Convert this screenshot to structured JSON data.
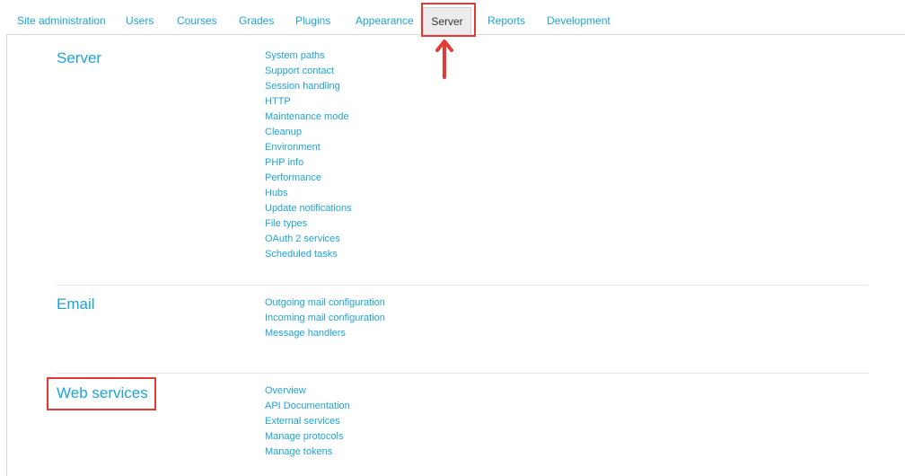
{
  "nav": {
    "tabs": [
      {
        "label": "Site administration"
      },
      {
        "label": "Users"
      },
      {
        "label": "Courses"
      },
      {
        "label": "Grades"
      },
      {
        "label": "Plugins"
      },
      {
        "label": "Appearance"
      },
      {
        "label": "Server"
      },
      {
        "label": "Reports"
      },
      {
        "label": "Development"
      }
    ],
    "active_tab": "Server"
  },
  "sections": [
    {
      "title": "Server",
      "links": [
        "System paths",
        "Support contact",
        "Session handling",
        "HTTP",
        "Maintenance mode",
        "Cleanup",
        "Environment",
        "PHP info",
        "Performance",
        "Hubs",
        "Update notifications",
        "File types",
        "OAuth 2 services",
        "Scheduled tasks"
      ]
    },
    {
      "title": "Email",
      "links": [
        "Outgoing mail configuration",
        "Incoming mail configuration",
        "Message handlers"
      ]
    },
    {
      "title": "Web services",
      "links": [
        "Overview",
        "API Documentation",
        "External services",
        "Manage protocols",
        "Manage tokens"
      ]
    }
  ],
  "colors": {
    "link": "#1ca3d6",
    "highlight": "#e53935",
    "active_tab_bg": "#ececec"
  }
}
